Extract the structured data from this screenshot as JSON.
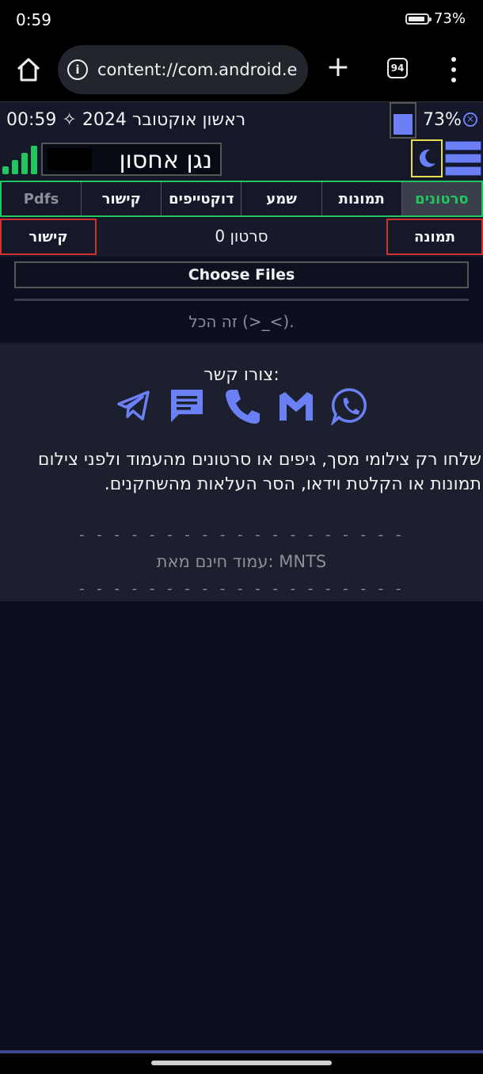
{
  "status_bar": {
    "time": "0:59",
    "battery": "73%"
  },
  "browser": {
    "url": "content://com.android.e",
    "tab_count": "94"
  },
  "page": {
    "datetime": "00:59 ✧ ראשון אוקטובר 2024",
    "battery_pct": "73%",
    "title": "נגן אחסון",
    "tabs": [
      {
        "label": "סרטונים",
        "active": true
      },
      {
        "label": "תמונות"
      },
      {
        "label": "שמע"
      },
      {
        "label": "דוקטייפים"
      },
      {
        "label": "קישור"
      },
      {
        "label": "Pdfs",
        "dim": true
      }
    ],
    "left_button": "קישור",
    "right_button": "תמונה",
    "counter": "סרטון 0",
    "choose_files": "Choose Files",
    "thats_all": "זה הכל (>_<).",
    "contact_title": "צורו קשר:",
    "contact_icons": [
      "telegram-icon",
      "sms-icon",
      "phone-icon",
      "gmail-icon",
      "whatsapp-icon"
    ],
    "message": "שלחו רק צילומי מסך, גיפים או סרטונים מהעמוד ולפני צילום תמונות או הקלטת וידאו, הסר העלאות מהשחקנים.",
    "dashes": "- - - - - - - - - - - - - - - - - - - -",
    "credit": "עמוד חינם מאת: MNTS",
    "accent": "#6b80f5",
    "green": "#22c55e",
    "red": "#d32f2f"
  }
}
